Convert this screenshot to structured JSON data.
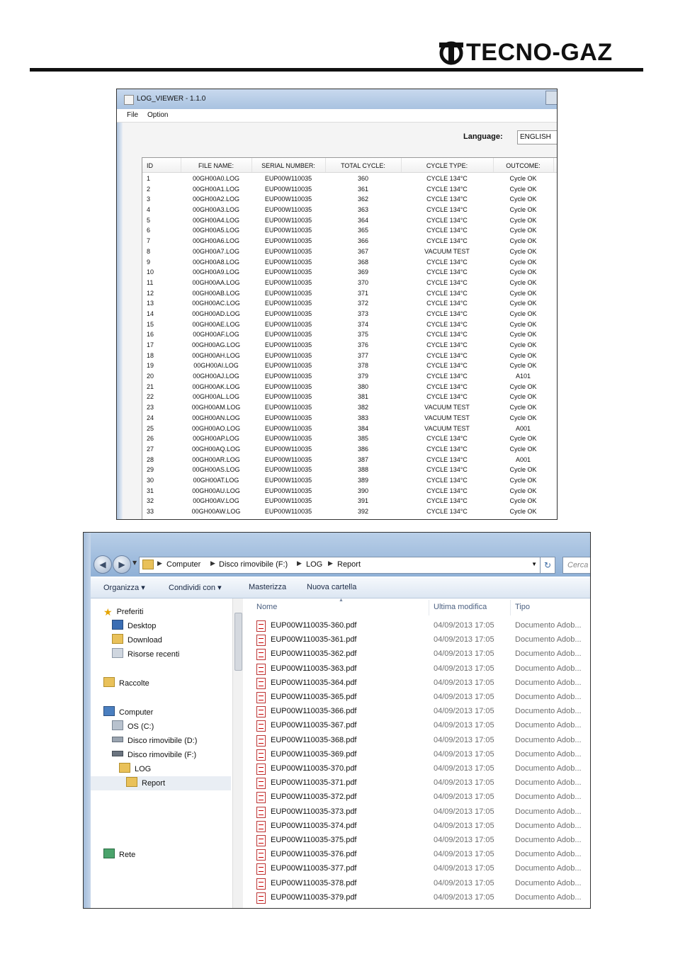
{
  "brand": {
    "name": "TECNO-GAZ"
  },
  "log_viewer": {
    "title": "LOG_VIEWER - 1.1.0",
    "menu": [
      "File",
      "Option"
    ],
    "language_label": "Language:",
    "language_value": "ENGLISH",
    "columns": [
      "ID",
      "FILE NAME:",
      "SERIAL NUMBER:",
      "TOTAL CYCLE:",
      "CYCLE TYPE:",
      "OUTCOME:"
    ],
    "rows": [
      [
        "1",
        "00GH00A0.LOG",
        "EUP00W110035",
        "360",
        "CYCLE 134°C",
        "Cycle OK"
      ],
      [
        "2",
        "00GH00A1.LOG",
        "EUP00W110035",
        "361",
        "CYCLE 134°C",
        "Cycle OK"
      ],
      [
        "3",
        "00GH00A2.LOG",
        "EUP00W110035",
        "362",
        "CYCLE 134°C",
        "Cycle OK"
      ],
      [
        "4",
        "00GH00A3.LOG",
        "EUP00W110035",
        "363",
        "CYCLE 134°C",
        "Cycle OK"
      ],
      [
        "5",
        "00GH00A4.LOG",
        "EUP00W110035",
        "364",
        "CYCLE 134°C",
        "Cycle OK"
      ],
      [
        "6",
        "00GH00A5.LOG",
        "EUP00W110035",
        "365",
        "CYCLE 134°C",
        "Cycle OK"
      ],
      [
        "7",
        "00GH00A6.LOG",
        "EUP00W110035",
        "366",
        "CYCLE 134°C",
        "Cycle OK"
      ],
      [
        "8",
        "00GH00A7.LOG",
        "EUP00W110035",
        "367",
        "VACUUM TEST",
        "Cycle OK"
      ],
      [
        "9",
        "00GH00A8.LOG",
        "EUP00W110035",
        "368",
        "CYCLE 134°C",
        "Cycle OK"
      ],
      [
        "10",
        "00GH00A9.LOG",
        "EUP00W110035",
        "369",
        "CYCLE 134°C",
        "Cycle OK"
      ],
      [
        "11",
        "00GH00AA.LOG",
        "EUP00W110035",
        "370",
        "CYCLE 134°C",
        "Cycle OK"
      ],
      [
        "12",
        "00GH00AB.LOG",
        "EUP00W110035",
        "371",
        "CYCLE 134°C",
        "Cycle OK"
      ],
      [
        "13",
        "00GH00AC.LOG",
        "EUP00W110035",
        "372",
        "CYCLE 134°C",
        "Cycle OK"
      ],
      [
        "14",
        "00GH00AD.LOG",
        "EUP00W110035",
        "373",
        "CYCLE 134°C",
        "Cycle OK"
      ],
      [
        "15",
        "00GH00AE.LOG",
        "EUP00W110035",
        "374",
        "CYCLE 134°C",
        "Cycle OK"
      ],
      [
        "16",
        "00GH00AF.LOG",
        "EUP00W110035",
        "375",
        "CYCLE 134°C",
        "Cycle OK"
      ],
      [
        "17",
        "00GH00AG.LOG",
        "EUP00W110035",
        "376",
        "CYCLE 134°C",
        "Cycle OK"
      ],
      [
        "18",
        "00GH00AH.LOG",
        "EUP00W110035",
        "377",
        "CYCLE 134°C",
        "Cycle OK"
      ],
      [
        "19",
        "00GH00AI.LOG",
        "EUP00W110035",
        "378",
        "CYCLE 134°C",
        "Cycle OK"
      ],
      [
        "20",
        "00GH00AJ.LOG",
        "EUP00W110035",
        "379",
        "CYCLE 134°C",
        "A101"
      ],
      [
        "21",
        "00GH00AK.LOG",
        "EUP00W110035",
        "380",
        "CYCLE 134°C",
        "Cycle OK"
      ],
      [
        "22",
        "00GH00AL.LOG",
        "EUP00W110035",
        "381",
        "CYCLE 134°C",
        "Cycle OK"
      ],
      [
        "23",
        "00GH00AM.LOG",
        "EUP00W110035",
        "382",
        "VACUUM TEST",
        "Cycle OK"
      ],
      [
        "24",
        "00GH00AN.LOG",
        "EUP00W110035",
        "383",
        "VACUUM TEST",
        "Cycle OK"
      ],
      [
        "25",
        "00GH00AO.LOG",
        "EUP00W110035",
        "384",
        "VACUUM TEST",
        "A001"
      ],
      [
        "26",
        "00GH00AP.LOG",
        "EUP00W110035",
        "385",
        "CYCLE 134°C",
        "Cycle OK"
      ],
      [
        "27",
        "00GH00AQ.LOG",
        "EUP00W110035",
        "386",
        "CYCLE 134°C",
        "Cycle OK"
      ],
      [
        "28",
        "00GH00AR.LOG",
        "EUP00W110035",
        "387",
        "CYCLE 134°C",
        "A001"
      ],
      [
        "29",
        "00GH00AS.LOG",
        "EUP00W110035",
        "388",
        "CYCLE 134°C",
        "Cycle OK"
      ],
      [
        "30",
        "00GH00AT.LOG",
        "EUP00W110035",
        "389",
        "CYCLE 134°C",
        "Cycle OK"
      ],
      [
        "31",
        "00GH00AU.LOG",
        "EUP00W110035",
        "390",
        "CYCLE 134°C",
        "Cycle OK"
      ],
      [
        "32",
        "00GH00AV.LOG",
        "EUP00W110035",
        "391",
        "CYCLE 134°C",
        "Cycle OK"
      ],
      [
        "33",
        "00GH00AW.LOG",
        "EUP00W110035",
        "392",
        "CYCLE 134°C",
        "Cycle OK"
      ]
    ]
  },
  "explorer": {
    "breadcrumb": [
      "Computer",
      "Disco rimovibile (F:)",
      "LOG",
      "Report"
    ],
    "search_placeholder": "Cerca",
    "toolbar": {
      "organize": "Organizza",
      "share": "Condividi con",
      "burn": "Masterizza",
      "new_folder": "Nuova cartella"
    },
    "nav": {
      "favorites": "Preferiti",
      "desktop": "Desktop",
      "downloads": "Download",
      "recent": "Risorse recenti",
      "libraries": "Raccolte",
      "computer": "Computer",
      "drive_c": "OS (C:)",
      "drive_d": "Disco rimovibile (D:)",
      "drive_f": "Disco rimovibile (F:)",
      "folder_log": "LOG",
      "folder_report": "Report",
      "network": "Rete"
    },
    "columns": {
      "name": "Nome",
      "modified": "Ultima modifica",
      "type": "Tipo"
    },
    "files": [
      {
        "name": "EUP00W110035-360.pdf",
        "date": "04/09/2013 17:05",
        "type": "Documento Adob..."
      },
      {
        "name": "EUP00W110035-361.pdf",
        "date": "04/09/2013 17:05",
        "type": "Documento Adob..."
      },
      {
        "name": "EUP00W110035-362.pdf",
        "date": "04/09/2013 17:05",
        "type": "Documento Adob..."
      },
      {
        "name": "EUP00W110035-363.pdf",
        "date": "04/09/2013 17:05",
        "type": "Documento Adob..."
      },
      {
        "name": "EUP00W110035-364.pdf",
        "date": "04/09/2013 17:05",
        "type": "Documento Adob..."
      },
      {
        "name": "EUP00W110035-365.pdf",
        "date": "04/09/2013 17:05",
        "type": "Documento Adob..."
      },
      {
        "name": "EUP00W110035-366.pdf",
        "date": "04/09/2013 17:05",
        "type": "Documento Adob..."
      },
      {
        "name": "EUP00W110035-367.pdf",
        "date": "04/09/2013 17:05",
        "type": "Documento Adob..."
      },
      {
        "name": "EUP00W110035-368.pdf",
        "date": "04/09/2013 17:05",
        "type": "Documento Adob..."
      },
      {
        "name": "EUP00W110035-369.pdf",
        "date": "04/09/2013 17:05",
        "type": "Documento Adob..."
      },
      {
        "name": "EUP00W110035-370.pdf",
        "date": "04/09/2013 17:05",
        "type": "Documento Adob..."
      },
      {
        "name": "EUP00W110035-371.pdf",
        "date": "04/09/2013 17:05",
        "type": "Documento Adob..."
      },
      {
        "name": "EUP00W110035-372.pdf",
        "date": "04/09/2013 17:05",
        "type": "Documento Adob..."
      },
      {
        "name": "EUP00W110035-373.pdf",
        "date": "04/09/2013 17:05",
        "type": "Documento Adob..."
      },
      {
        "name": "EUP00W110035-374.pdf",
        "date": "04/09/2013 17:05",
        "type": "Documento Adob..."
      },
      {
        "name": "EUP00W110035-375.pdf",
        "date": "04/09/2013 17:05",
        "type": "Documento Adob..."
      },
      {
        "name": "EUP00W110035-376.pdf",
        "date": "04/09/2013 17:05",
        "type": "Documento Adob..."
      },
      {
        "name": "EUP00W110035-377.pdf",
        "date": "04/09/2013 17:05",
        "type": "Documento Adob..."
      },
      {
        "name": "EUP00W110035-378.pdf",
        "date": "04/09/2013 17:05",
        "type": "Documento Adob..."
      },
      {
        "name": "EUP00W110035-379.pdf",
        "date": "04/09/2013 17:05",
        "type": "Documento Adob..."
      }
    ]
  }
}
